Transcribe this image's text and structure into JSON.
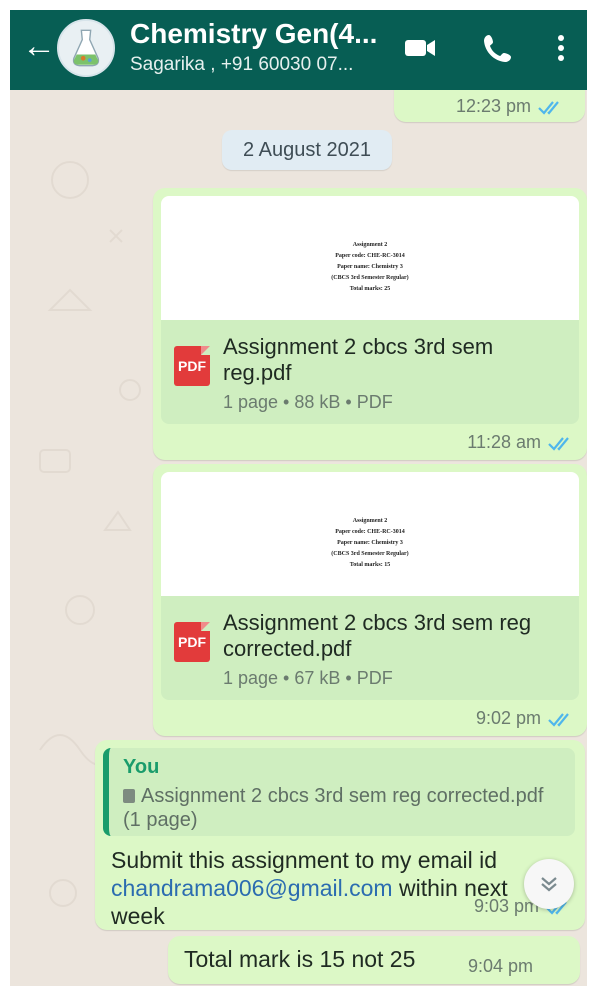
{
  "header": {
    "title": "Chemistry Gen(4...",
    "subtitle": "Sagarika , +91 60030 07...",
    "icons": [
      "back-arrow-icon",
      "group-avatar",
      "video-call-icon",
      "phone-call-icon",
      "more-options-icon"
    ]
  },
  "chat": {
    "prev_message_time": "12:23 pm",
    "date_chip": "2 August 2021",
    "documents": [
      {
        "preview_lines": [
          "Assignment 2",
          "Paper code: CHE-RC-3014",
          "Paper name: Chemistry 3",
          "(CBCS 3rd Semester Regular)",
          "Total marks: 25"
        ],
        "file_name": "Assignment 2 cbcs 3rd sem reg.pdf",
        "meta": "1 page • 88 kB • PDF",
        "icon_label": "PDF",
        "time": "11:28 am"
      },
      {
        "preview_lines": [
          "Assignment 2",
          "Paper code: CHE-RC-3014",
          "Paper name: Chemistry 3",
          "(CBCS 3rd Semester Regular)",
          "Total marks: 15"
        ],
        "file_name": "Assignment 2 cbcs 3rd sem reg corrected.pdf",
        "meta": "1 page • 67 kB • PDF",
        "icon_label": "PDF",
        "time": "9:02 pm"
      }
    ],
    "reply": {
      "quote_sender": "You",
      "quote_text": "Assignment 2 cbcs 3rd sem reg corrected.pdf (1 page)",
      "text_before_link": "Submit this assignment to my email id ",
      "link": "chandrama006@gmail.com",
      "text_after_link": " within next week",
      "time": "9:03 pm"
    },
    "last_message": {
      "text": "Total mark is 15 not 25",
      "time": "9:04 pm"
    }
  },
  "colors": {
    "header": "#075e54",
    "outgoing_bubble": "#dcf8c6",
    "chat_background": "#ece5dd",
    "read_ticks": "#4fb6ec",
    "link": "#2b6cb0"
  }
}
